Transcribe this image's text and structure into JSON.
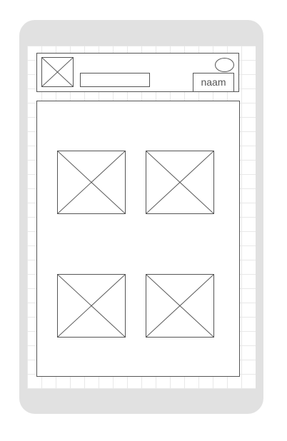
{
  "header": {
    "name_label": "naam"
  },
  "content": {
    "images": [
      {
        "icon": "image-placeholder-icon"
      },
      {
        "icon": "image-placeholder-icon"
      },
      {
        "icon": "image-placeholder-icon"
      },
      {
        "icon": "image-placeholder-icon"
      }
    ]
  },
  "colors": {
    "device_frame": "#e1e1e1",
    "screen_background": "#ffffff",
    "grid_lines": "#e8e8e8",
    "wireframe_stroke": "#555555"
  }
}
